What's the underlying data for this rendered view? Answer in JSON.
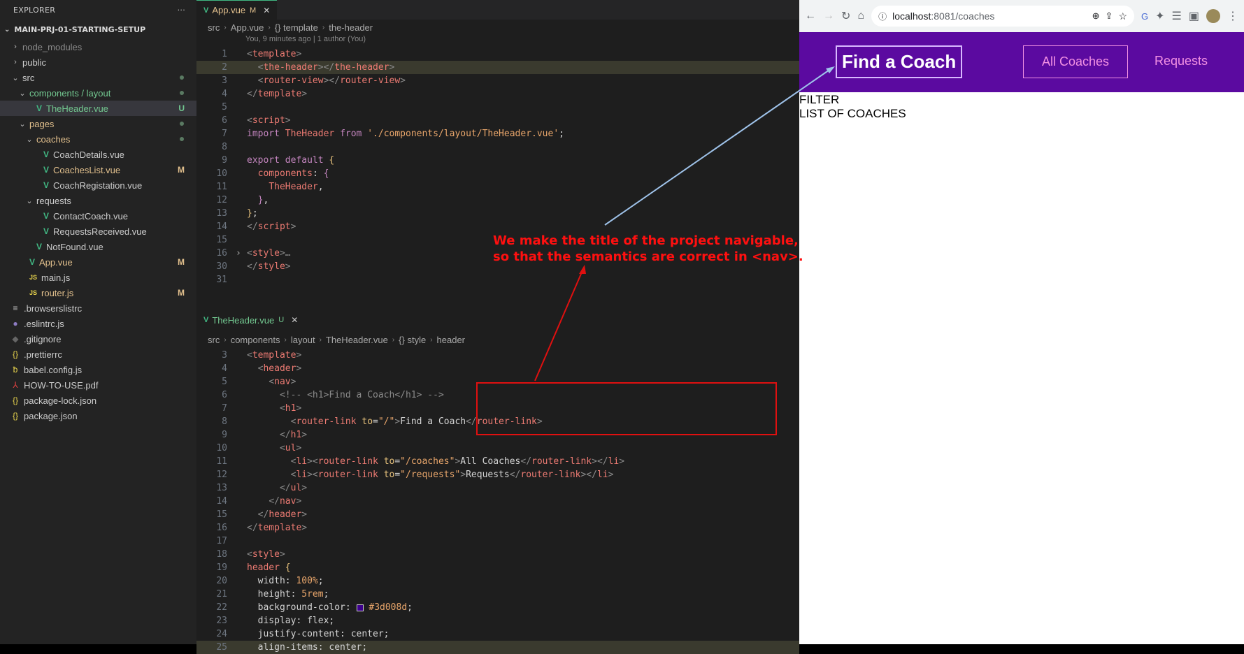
{
  "explorer": {
    "title": "EXPLORER",
    "more": "···",
    "project": "MAIN-PRJ-01-STARTING-SETUP",
    "items": [
      {
        "label": "node_modules",
        "kind": "folder-closed",
        "indent": 0,
        "color": "grey"
      },
      {
        "label": "public",
        "kind": "folder-closed",
        "indent": 0
      },
      {
        "label": "src",
        "kind": "folder-open",
        "indent": 0,
        "dot": true
      },
      {
        "label": "components / layout",
        "kind": "folder-open",
        "indent": 1,
        "color": "green",
        "dot": true
      },
      {
        "label": "TheHeader.vue",
        "kind": "vue",
        "indent": 2,
        "color": "green",
        "badge": "U",
        "selected": true
      },
      {
        "label": "pages",
        "kind": "folder-open",
        "indent": 1,
        "color": "yellow",
        "dot": true
      },
      {
        "label": "coaches",
        "kind": "folder-open",
        "indent": 2,
        "color": "yellow",
        "dot": true
      },
      {
        "label": "CoachDetails.vue",
        "kind": "vue",
        "indent": 3
      },
      {
        "label": "CoachesList.vue",
        "kind": "vue",
        "indent": 3,
        "color": "yellow",
        "badge": "M"
      },
      {
        "label": "CoachRegistation.vue",
        "kind": "vue",
        "indent": 3
      },
      {
        "label": "requests",
        "kind": "folder-open",
        "indent": 2
      },
      {
        "label": "ContactCoach.vue",
        "kind": "vue",
        "indent": 3
      },
      {
        "label": "RequestsReceived.vue",
        "kind": "vue",
        "indent": 3
      },
      {
        "label": "NotFound.vue",
        "kind": "vue",
        "indent": 2
      },
      {
        "label": "App.vue",
        "kind": "vue",
        "indent": 1,
        "color": "yellow",
        "badge": "M"
      },
      {
        "label": "main.js",
        "kind": "js",
        "indent": 1
      },
      {
        "label": "router.js",
        "kind": "js",
        "indent": 1,
        "color": "yellow",
        "badge": "M"
      },
      {
        "label": ".browserslistrc",
        "kind": "lines",
        "indent": 0
      },
      {
        "label": ".eslintrc.js",
        "kind": "eslint",
        "indent": 0
      },
      {
        "label": ".gitignore",
        "kind": "git",
        "indent": 0
      },
      {
        "label": ".prettierrc",
        "kind": "json",
        "indent": 0
      },
      {
        "label": "babel.config.js",
        "kind": "babel",
        "indent": 0
      },
      {
        "label": "HOW-TO-USE.pdf",
        "kind": "pdf",
        "indent": 0
      },
      {
        "label": "package-lock.json",
        "kind": "json",
        "indent": 0
      },
      {
        "label": "package.json",
        "kind": "json",
        "indent": 0
      }
    ]
  },
  "editor1": {
    "tab_label": "App.vue",
    "tab_status": "M",
    "breadcrumb": [
      "src",
      "App.vue",
      "{} template",
      "the-header"
    ],
    "blame": "You, 9 minutes ago | 1 author (You)",
    "lines": [
      {
        "n": "1",
        "html": "<span class='t-g'>&lt;</span><span class='t-tag'>template</span><span class='t-g'>&gt;</span>"
      },
      {
        "n": "2",
        "hl": true,
        "html": "  <span class='t-g'>&lt;</span><span class='t-tag'>the-header</span><span class='t-g'>&gt;&lt;/</span><span class='t-tag'>the-header</span><span class='t-g'>&gt;</span>"
      },
      {
        "n": "3",
        "html": "  <span class='t-g'>&lt;</span><span class='t-tag'>router-view</span><span class='t-g'>&gt;&lt;/</span><span class='t-tag'>router-view</span><span class='t-g'>&gt;</span>"
      },
      {
        "n": "4",
        "html": "<span class='t-g'>&lt;/</span><span class='t-tag'>template</span><span class='t-g'>&gt;</span>"
      },
      {
        "n": "5",
        "html": ""
      },
      {
        "n": "6",
        "html": "<span class='t-g'>&lt;</span><span class='t-tag'>script</span><span class='t-g'>&gt;</span>"
      },
      {
        "n": "7",
        "html": "<span class='t-k'>import</span> <span class='t-tag'>TheHeader</span> <span class='t-k'>from</span> <span class='t-s'>'./components/layout/TheHeader.vue'</span>;"
      },
      {
        "n": "8",
        "html": ""
      },
      {
        "n": "9",
        "html": "<span class='t-k'>export default</span> <span class='t-a'>{</span>"
      },
      {
        "n": "10",
        "html": "  <span class='t-tag'>components</span>: <span class='t-k'>{</span>"
      },
      {
        "n": "11",
        "html": "    <span class='t-tag'>TheHeader</span>,"
      },
      {
        "n": "12",
        "html": "  <span class='t-k'>}</span>,"
      },
      {
        "n": "13",
        "html": "<span class='t-a'>}</span>;"
      },
      {
        "n": "14",
        "html": "<span class='t-g'>&lt;/</span><span class='t-tag'>script</span><span class='t-g'>&gt;</span>"
      },
      {
        "n": "15",
        "html": ""
      },
      {
        "n": "16",
        "fold": true,
        "html": "<span class='t-g'>&lt;</span><span class='t-tag'>style</span><span class='t-g'>&gt;…</span>"
      },
      {
        "n": "30",
        "html": "<span class='t-g'>&lt;/</span><span class='t-tag'>style</span><span class='t-g'>&gt;</span>"
      },
      {
        "n": "31",
        "html": ""
      }
    ]
  },
  "editor2": {
    "tab_label": "TheHeader.vue",
    "tab_status": "U",
    "breadcrumb": [
      "src",
      "components",
      "layout",
      "TheHeader.vue",
      "{} style",
      "header"
    ],
    "lines": [
      {
        "n": "3",
        "html": "<span class='t-g'>&lt;</span><span class='t-tag'>template</span><span class='t-g'>&gt;</span>"
      },
      {
        "n": "4",
        "html": "  <span class='t-g'>&lt;</span><span class='t-tag'>header</span><span class='t-g'>&gt;</span>"
      },
      {
        "n": "5",
        "html": "    <span class='t-g'>&lt;</span><span class='t-tag'>nav</span><span class='t-g'>&gt;</span>"
      },
      {
        "n": "6",
        "html": "      <span class='t-g'>&lt;!-- &lt;h1&gt;Find a Coach&lt;/h1&gt; --&gt;</span>"
      },
      {
        "n": "7",
        "html": "      <span class='t-g'>&lt;</span><span class='t-tag'>h1</span><span class='t-g'>&gt;</span>"
      },
      {
        "n": "8",
        "html": "        <span class='t-g'>&lt;</span><span class='t-tag'>router-link</span> <span class='t-a'>to</span>=<span class='t-s'>\"/\"</span><span class='t-g'>&gt;</span>Find a Coach<span class='t-g'>&lt;/</span><span class='t-tag'>router-link</span><span class='t-g'>&gt;</span>"
      },
      {
        "n": "9",
        "html": "      <span class='t-g'>&lt;/</span><span class='t-tag'>h1</span><span class='t-g'>&gt;</span>"
      },
      {
        "n": "10",
        "html": "      <span class='t-g'>&lt;</span><span class='t-tag'>ul</span><span class='t-g'>&gt;</span>"
      },
      {
        "n": "11",
        "html": "        <span class='t-g'>&lt;</span><span class='t-tag'>li</span><span class='t-g'>&gt;&lt;</span><span class='t-tag'>router-link</span> <span class='t-a'>to</span>=<span class='t-s'>\"/coaches\"</span><span class='t-g'>&gt;</span>All Coaches<span class='t-g'>&lt;/</span><span class='t-tag'>router-link</span><span class='t-g'>&gt;&lt;/</span><span class='t-tag'>li</span><span class='t-g'>&gt;</span>"
      },
      {
        "n": "12",
        "html": "        <span class='t-g'>&lt;</span><span class='t-tag'>li</span><span class='t-g'>&gt;&lt;</span><span class='t-tag'>router-link</span> <span class='t-a'>to</span>=<span class='t-s'>\"/requests\"</span><span class='t-g'>&gt;</span>Requests<span class='t-g'>&lt;/</span><span class='t-tag'>router-link</span><span class='t-g'>&gt;&lt;/</span><span class='t-tag'>li</span><span class='t-g'>&gt;</span>"
      },
      {
        "n": "13",
        "html": "      <span class='t-g'>&lt;/</span><span class='t-tag'>ul</span><span class='t-g'>&gt;</span>"
      },
      {
        "n": "14",
        "html": "    <span class='t-g'>&lt;/</span><span class='t-tag'>nav</span><span class='t-g'>&gt;</span>"
      },
      {
        "n": "15",
        "html": "  <span class='t-g'>&lt;/</span><span class='t-tag'>header</span><span class='t-g'>&gt;</span>"
      },
      {
        "n": "16",
        "html": "<span class='t-g'>&lt;/</span><span class='t-tag'>template</span><span class='t-g'>&gt;</span>"
      },
      {
        "n": "17",
        "html": ""
      },
      {
        "n": "18",
        "html": "<span class='t-g'>&lt;</span><span class='t-tag'>style</span><span class='t-g'>&gt;</span>"
      },
      {
        "n": "19",
        "html": "<span class='t-tag'>header</span> <span class='t-a'>{</span>"
      },
      {
        "n": "20",
        "html": "  width: <span class='t-s'>100%</span>;"
      },
      {
        "n": "21",
        "html": "  height: <span class='t-s'>5rem</span>;"
      },
      {
        "n": "22",
        "html": "  background-color: <span style='display:inline-block;width:10px;height:10px;border:1px solid #ccc;background:#3d008d;vertical-align:middle'></span> <span class='t-s'>#3d008d</span>;"
      },
      {
        "n": "23",
        "html": "  display: flex;"
      },
      {
        "n": "24",
        "html": "  justify-content: center;"
      },
      {
        "n": "25",
        "hl": true,
        "html": "  align-items: center;"
      }
    ]
  },
  "browser": {
    "url_host": "localhost",
    "url_path": ":8081/coaches",
    "colors": {
      "header_bg": "#5b0aa0",
      "link": "#f391e3",
      "annotation": "#ff1010"
    },
    "brand": "Find a Coach",
    "nav": [
      "All Coaches",
      "Requests"
    ],
    "filter": "FILTER",
    "list": "LIST OF COACHES"
  },
  "annotation": {
    "text": "We make the title of the project navigable,\nso that the semantics are correct in <nav>."
  }
}
